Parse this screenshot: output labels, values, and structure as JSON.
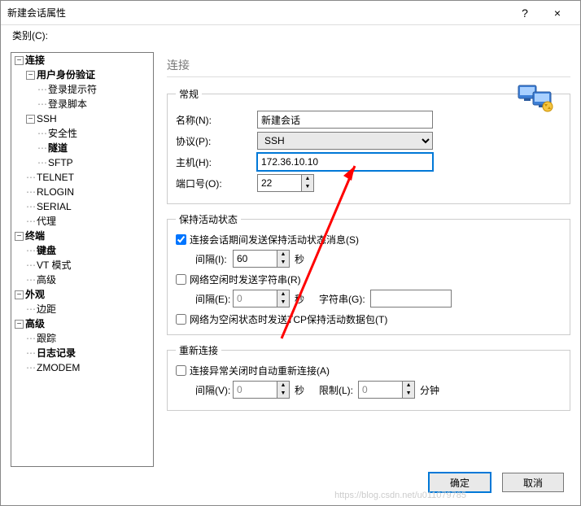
{
  "window": {
    "title": "新建会话属性",
    "help": "?",
    "close": "×"
  },
  "category_label": "类别(C):",
  "tree": {
    "connection": "连接",
    "auth": "用户身份验证",
    "login_prompt": "登录提示符",
    "login_script": "登录脚本",
    "ssh": "SSH",
    "security": "安全性",
    "tunnel": "隧道",
    "sftp": "SFTP",
    "telnet": "TELNET",
    "rlogin": "RLOGIN",
    "serial": "SERIAL",
    "proxy": "代理",
    "terminal": "终端",
    "keyboard": "键盘",
    "vt_mode": "VT 模式",
    "advanced1": "高级",
    "appearance": "外观",
    "margin": "边距",
    "advanced2": "高级",
    "trace": "跟踪",
    "log": "日志记录",
    "zmodem": "ZMODEM"
  },
  "panel_title": "连接",
  "general": {
    "legend": "常规",
    "name_label": "名称(N):",
    "name_value": "新建会话",
    "proto_label": "协议(P):",
    "proto_value": "SSH",
    "host_label": "主机(H):",
    "host_value": "172.36.10.10",
    "port_label": "端口号(O):",
    "port_value": "22"
  },
  "keepalive": {
    "legend": "保持活动状态",
    "cb1": "连接会话期间发送保持活动状态消息(S)",
    "interval1_label": "间隔(I):",
    "interval1_value": "60",
    "sec": "秒",
    "cb2": "网络空闲时发送字符串(R)",
    "interval2_label": "间隔(E):",
    "interval2_value": "0",
    "str_label": "字符串(G):",
    "str_value": "",
    "cb3": "网络为空闲状态时发送TCP保持活动数据包(T)"
  },
  "reconnect": {
    "legend": "重新连接",
    "cb": "连接异常关闭时自动重新连接(A)",
    "interval_label": "间隔(V):",
    "interval_value": "0",
    "sec": "秒",
    "limit_label": "限制(L):",
    "limit_value": "0",
    "min": "分钟"
  },
  "buttons": {
    "ok": "确定",
    "cancel": "取消"
  },
  "watermark": "https://blog.csdn.net/u011079785"
}
